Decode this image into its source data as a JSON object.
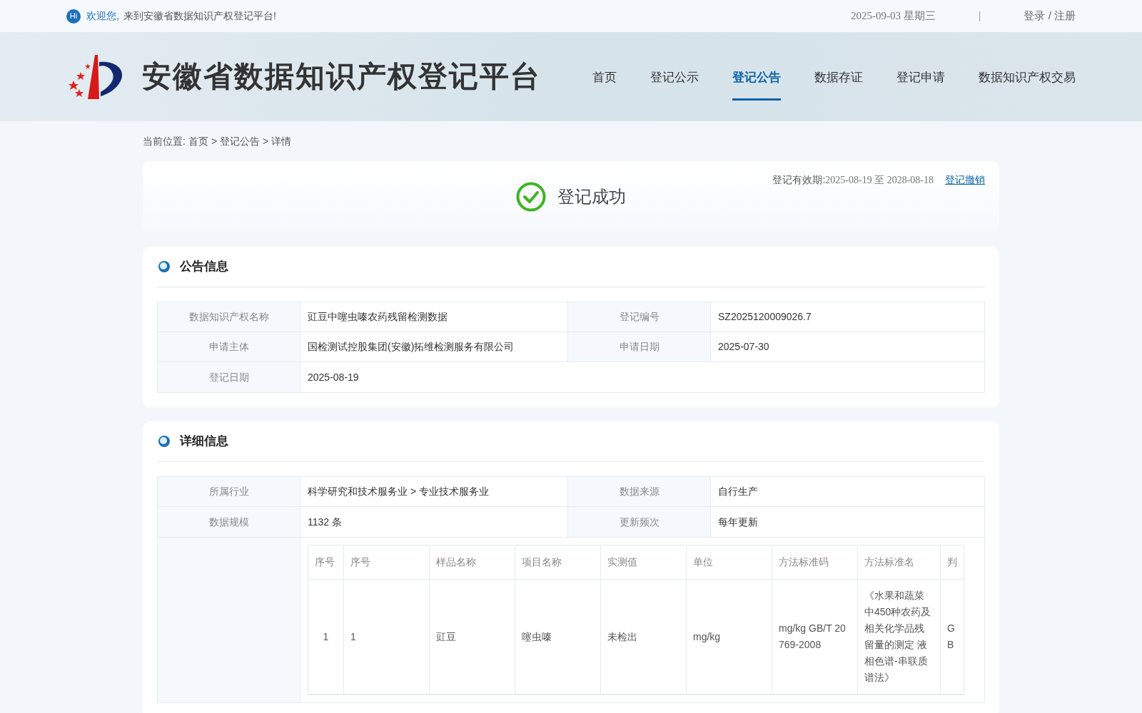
{
  "topbar": {
    "hi_badge": "Hi",
    "greeting": "欢迎您,",
    "welcome": "来到安徽省数据知识产权登记平台!",
    "date": "2025-09-03 星期三",
    "separator": "|",
    "login": "登录 / 注册"
  },
  "header": {
    "site_title": "安徽省数据知识产权登记平台",
    "nav": [
      {
        "label": "首页",
        "selected": false
      },
      {
        "label": "登记公示",
        "selected": false
      },
      {
        "label": "登记公告",
        "selected": true
      },
      {
        "label": "数据存证",
        "selected": false
      },
      {
        "label": "登记申请",
        "selected": false
      },
      {
        "label": "数据知识产权交易",
        "selected": false
      }
    ]
  },
  "breadcrumb": {
    "label": "当前位置:",
    "items": [
      "首页",
      "登记公告",
      "详情"
    ],
    "separator": ">"
  },
  "status": {
    "text": "登记成功",
    "validity_label": "登记有效期:",
    "validity": "2025-08-19 至 2028-08-18",
    "revoke": "登记撤销"
  },
  "announcement": {
    "title": "公告信息",
    "rows": [
      [
        {
          "label": "数据知识产权名称",
          "value": "豇豆中噻虫嗪农药残留检测数据"
        },
        {
          "label": "登记编号",
          "value": "SZ2025120009026.7"
        }
      ],
      [
        {
          "label": "申请主体",
          "value": "国检测试控股集团(安徽)拓维检测服务有限公司"
        },
        {
          "label": "申请日期",
          "value": "2025-07-30"
        }
      ],
      [
        {
          "label": "登记日期",
          "value": "2025-08-19"
        }
      ]
    ]
  },
  "details": {
    "title": "详细信息",
    "rows": [
      [
        {
          "label": "所属行业",
          "value": "科学研究和技术服务业 > 专业技术服务业"
        },
        {
          "label": "数据来源",
          "value": "自行生产"
        }
      ],
      [
        {
          "label": "数据规模",
          "value": "1132 条"
        },
        {
          "label": "更新频次",
          "value": "每年更新"
        }
      ]
    ],
    "sample_table": {
      "columns": [
        "序号",
        "序号",
        "样品名称",
        "项目名称",
        "实测值",
        "单位",
        "方法标准码",
        "方法标准名",
        "判"
      ],
      "rows": [
        [
          "1",
          "1",
          "豇豆",
          "噻虫嗪",
          "未检出",
          "mg/kg",
          "mg/kg GB/T 20769-2008",
          "《水果和蔬菜中450种农药及相关化学品残留量的测定 液相色谱-串联质谱法》",
          "GB"
        ]
      ]
    }
  }
}
